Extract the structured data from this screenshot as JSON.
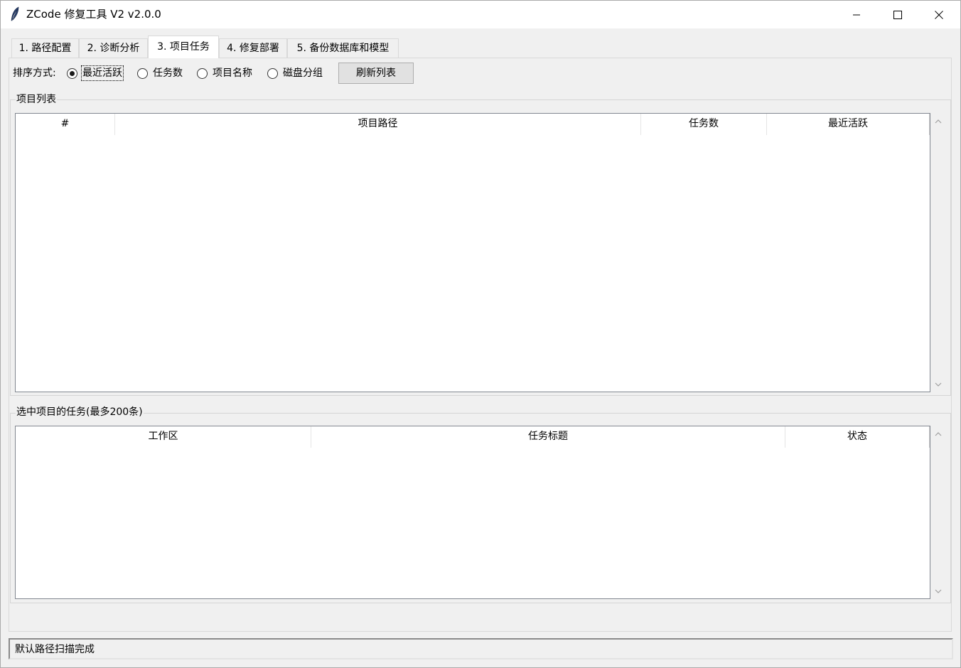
{
  "window": {
    "title": "ZCode 修复工具 V2 v2.0.0",
    "icon": "feather-icon"
  },
  "tabs": [
    {
      "label": "1. 路径配置",
      "active": false
    },
    {
      "label": "2. 诊断分析",
      "active": false
    },
    {
      "label": "3. 项目任务",
      "active": true
    },
    {
      "label": "4. 修复部署",
      "active": false
    },
    {
      "label": "5. 备份数据库和模型",
      "active": false
    }
  ],
  "sort": {
    "label": "排序方式:",
    "options": [
      {
        "label": "最近活跃",
        "selected": true
      },
      {
        "label": "任务数",
        "selected": false
      },
      {
        "label": "项目名称",
        "selected": false
      },
      {
        "label": "磁盘分组",
        "selected": false
      }
    ],
    "refresh_label": "刷新列表"
  },
  "project_list": {
    "title": "项目列表",
    "columns": [
      "#",
      "项目路径",
      "任务数",
      "最近活跃"
    ],
    "rows": []
  },
  "task_list": {
    "title": "选中项目的任务(最多200条)",
    "columns": [
      "工作区",
      "任务标题",
      "状态"
    ],
    "rows": []
  },
  "status": {
    "text": "默认路径扫描完成"
  }
}
